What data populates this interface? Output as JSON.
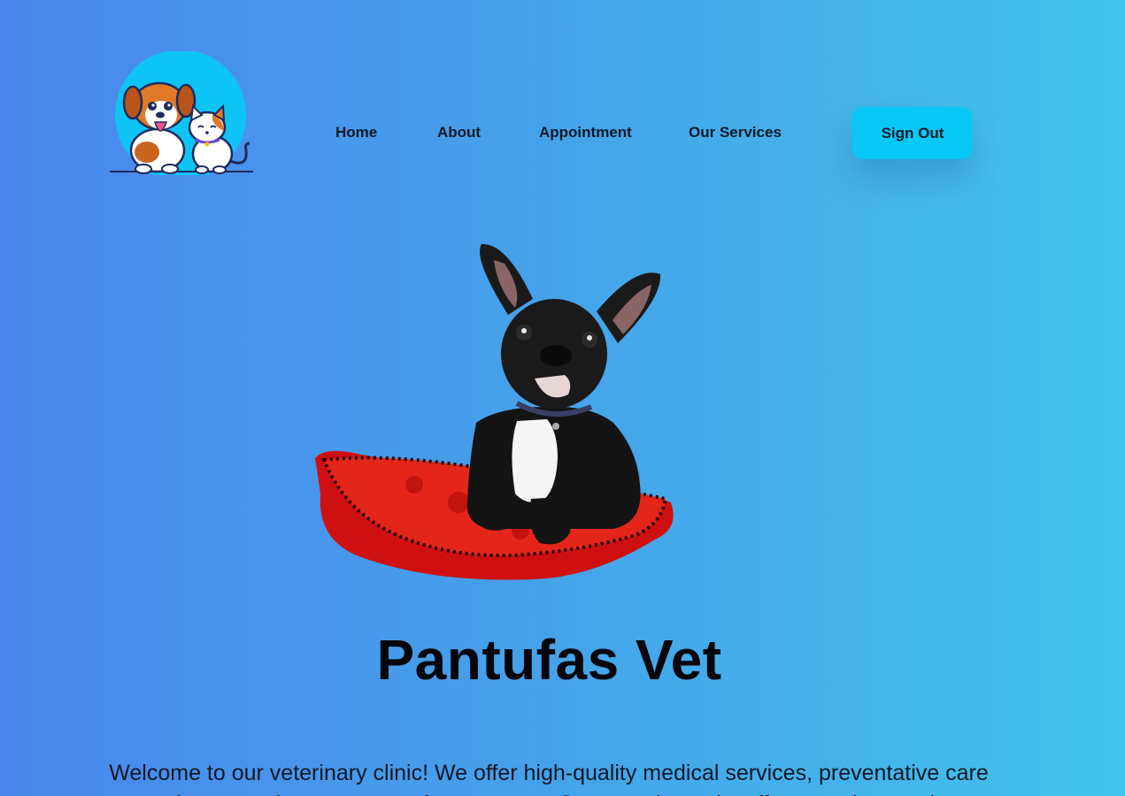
{
  "logo": {
    "icon": "dog-and-cat-logo-icon",
    "alt": "Pantufas Vet logo"
  },
  "nav": {
    "items": [
      {
        "label": "Home"
      },
      {
        "label": "About"
      },
      {
        "label": "Appointment"
      },
      {
        "label": "Our Services"
      }
    ],
    "signout_label": "Sign Out"
  },
  "hero": {
    "image": "french-bulldog-on-red-cushion",
    "title": "Pantufas Vet",
    "intro": "Welcome to our veterinary clinic! We offer high-quality medical services, preventative care and compassionate support for your pets. Our experienced staff are ready to make"
  },
  "colors": {
    "background_start": "#4a86ec",
    "background_end": "#42c4ea",
    "button": "#08c8f6",
    "text": "#111827"
  }
}
